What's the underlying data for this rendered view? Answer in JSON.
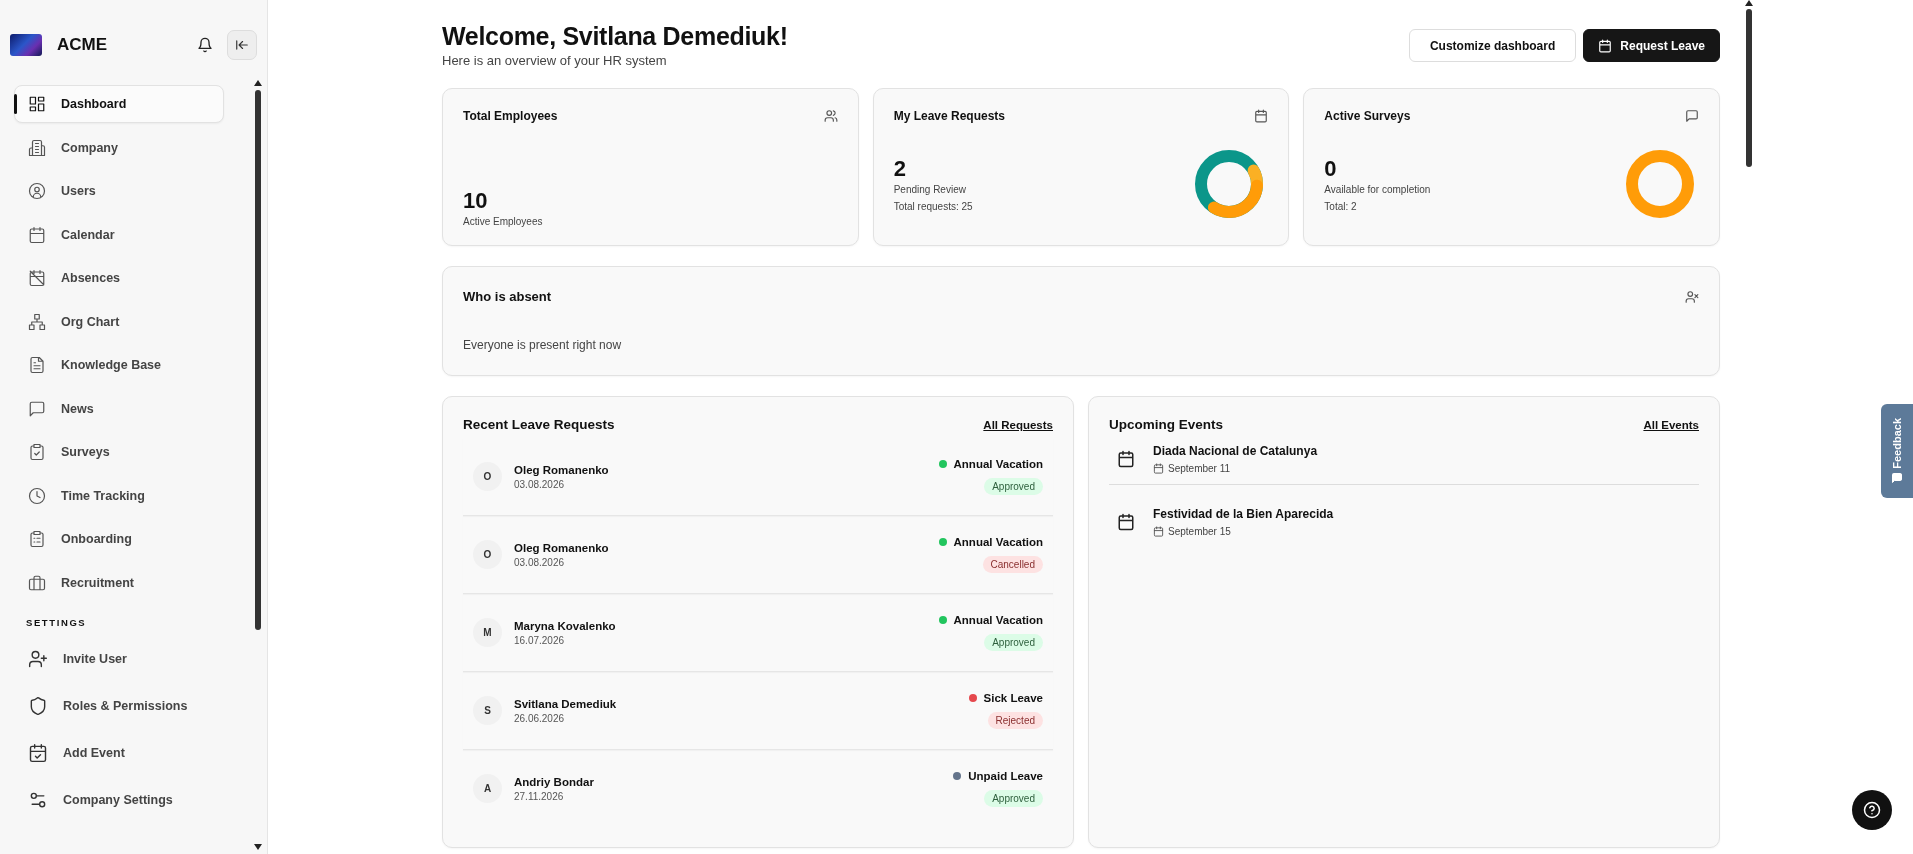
{
  "sidebar": {
    "brand": "ACME",
    "items": [
      {
        "label": "Dashboard",
        "selected": true
      },
      {
        "label": "Company",
        "selected": false
      },
      {
        "label": "Users",
        "selected": false
      },
      {
        "label": "Calendar",
        "selected": false
      },
      {
        "label": "Absences",
        "selected": false
      },
      {
        "label": "Org Chart",
        "selected": false
      },
      {
        "label": "Knowledge Base",
        "selected": false
      },
      {
        "label": "News",
        "selected": false
      },
      {
        "label": "Surveys",
        "selected": false
      },
      {
        "label": "Time Tracking",
        "selected": false
      },
      {
        "label": "Onboarding",
        "selected": false
      },
      {
        "label": "Recruitment",
        "selected": false
      }
    ],
    "settings_heading": "SETTINGS",
    "settings_items": [
      {
        "label": "Invite User"
      },
      {
        "label": "Roles & Permissions"
      },
      {
        "label": "Add Event"
      },
      {
        "label": "Company Settings"
      }
    ]
  },
  "header": {
    "title": "Welcome, Svitlana Demediuk!",
    "subtitle": "Here is an overview of your HR system",
    "buttons": [
      {
        "label": "Customize dashboard",
        "kind": "secondary"
      },
      {
        "label": "Request Leave",
        "kind": "primary"
      }
    ]
  },
  "stats": [
    {
      "title": "Total Employees",
      "value": "10",
      "caption": "Active Employees",
      "kind": "plain"
    },
    {
      "title": "My Leave Requests",
      "value": "2",
      "caption": "Pending Review",
      "detail": "Total requests: 25",
      "kind": "donut"
    },
    {
      "title": "Active Surveys",
      "value": "0",
      "caption": "Available for completion",
      "detail": "Total: 2",
      "kind": "ring"
    }
  ],
  "absent": {
    "title": "Who is absent",
    "message": "Everyone is present right now"
  },
  "requests": {
    "title": "Recent Leave Requests",
    "link": "All Requests",
    "items": [
      {
        "initial": "O",
        "name": "Oleg Romanenko",
        "date": "03.08.2026",
        "type": "Annual Vacation",
        "color": "#22c55e",
        "status": "Approved",
        "kind": "approved"
      },
      {
        "initial": "O",
        "name": "Oleg Romanenko",
        "date": "03.08.2026",
        "type": "Annual Vacation",
        "color": "#22c55e",
        "status": "Cancelled",
        "kind": "cancelled"
      },
      {
        "initial": "M",
        "name": "Maryna Kovalenko",
        "date": "16.07.2026",
        "type": "Annual Vacation",
        "color": "#22c55e",
        "status": "Approved",
        "kind": "approved"
      },
      {
        "initial": "S",
        "name": "Svitlana Demediuk",
        "date": "26.06.2026",
        "type": "Sick Leave",
        "color": "#e5484d",
        "status": "Rejected",
        "kind": "rejected"
      },
      {
        "initial": "A",
        "name": "Andriy Bondar",
        "date": "27.11.2026",
        "type": "Unpaid Leave",
        "color": "#64748b",
        "status": "Approved",
        "kind": "approved"
      }
    ]
  },
  "events": {
    "title": "Upcoming Events",
    "link": "All Events",
    "items": [
      {
        "name": "Diada Nacional de Catalunya",
        "date": "September 11"
      },
      {
        "name": "Festividad de la Bien Aparecida",
        "date": "September 15"
      }
    ]
  },
  "feedback": "Feedback"
}
